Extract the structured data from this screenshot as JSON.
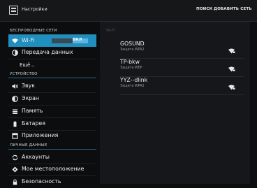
{
  "topbar": {
    "title": "Настройки",
    "actions": [
      "ПОИСК",
      "ДОБАВИТЬ СЕТЬ"
    ]
  },
  "sidebar": {
    "sections": [
      {
        "header": "БЕСПРОВОДНЫЕ СЕТИ"
      },
      {
        "header": "УСТРОЙСТВО"
      },
      {
        "header": "ЛИЧНЫЕ ДАННЫЕ"
      }
    ],
    "items": [
      {
        "label": "Wi-Fi",
        "icon": "wifi-icon",
        "toggle": "ВКЛ",
        "active": true
      },
      {
        "label": "Передача данных",
        "icon": "data-usage-icon"
      },
      {
        "label": "Ещё...",
        "icon": ""
      },
      {
        "label": "Звук",
        "icon": "sound-icon"
      },
      {
        "label": "Экран",
        "icon": "display-icon"
      },
      {
        "label": "Память",
        "icon": "storage-icon"
      },
      {
        "label": "Батарея",
        "icon": "battery-icon"
      },
      {
        "label": "Приложения",
        "icon": "apps-icon"
      },
      {
        "label": "Аккаунты",
        "icon": "sync-icon"
      },
      {
        "label": "Мое местоположение",
        "icon": "location-icon"
      },
      {
        "label": "Безопасность",
        "icon": "lock-icon"
      }
    ]
  },
  "panel": {
    "title": "Wi-Fi",
    "networks": [
      {
        "name": "GOSUND",
        "security": "Защита WPA2",
        "icon": "wifi-signal-locked-icon"
      },
      {
        "name": "TP-bkw",
        "security": "Защита WEP",
        "icon": "wifi-signal-locked-icon"
      },
      {
        "name": "YYZ--dlink",
        "security": "Защита WPA2",
        "icon": "wifi-signal-locked-icon"
      }
    ]
  },
  "colors": {
    "accent": "#1e8fbf",
    "toggle_on": "#5bb7e2",
    "background": "#0c0d0f",
    "panel": "#15171a"
  }
}
